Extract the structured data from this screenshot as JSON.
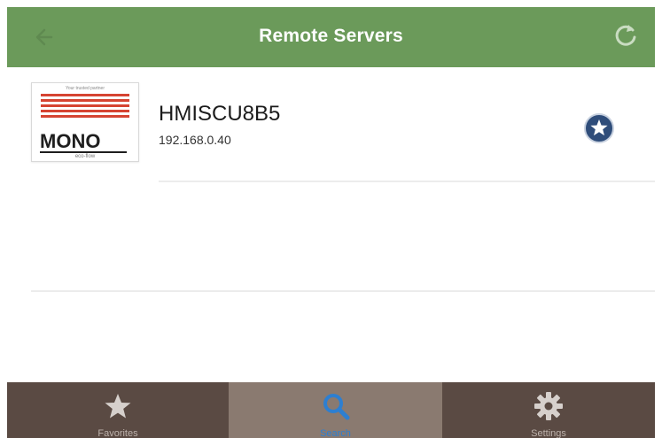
{
  "header": {
    "title": "Remote Servers",
    "color": "#6b9a5a"
  },
  "servers": [
    {
      "name": "HMISCU8B5",
      "ip": "192.168.0.40",
      "logo": {
        "tagline": "Your trusted partner",
        "word": "MONO",
        "sub": "eco-flow"
      },
      "favorite_icon": "star-badge-icon"
    }
  ],
  "tabbar": {
    "active": "search",
    "tabs": [
      {
        "id": "favorites",
        "label": "Favorites",
        "icon": "star-icon"
      },
      {
        "id": "search",
        "label": "Search",
        "icon": "search-icon"
      },
      {
        "id": "settings",
        "label": "Settings",
        "icon": "gear-icon"
      }
    ],
    "colors": {
      "bar": "#5a4a43",
      "active_bg": "#8a7a70",
      "active_label": "#2d7fd1"
    }
  }
}
